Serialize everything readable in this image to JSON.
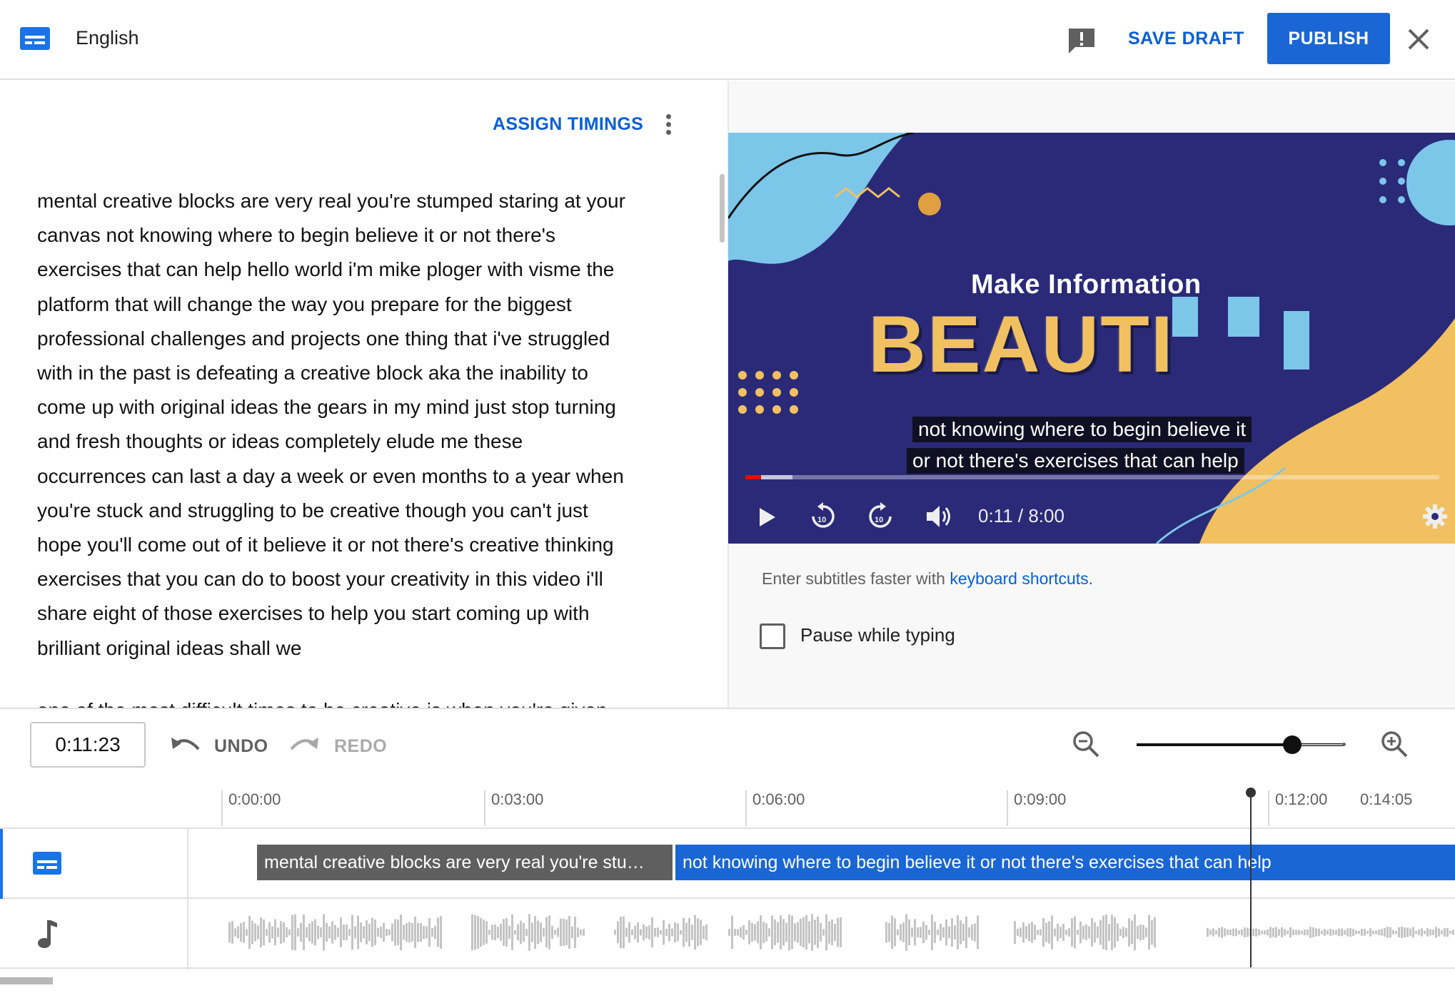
{
  "header": {
    "language": "English",
    "save_draft": "SAVE DRAFT",
    "publish": "PUBLISH"
  },
  "editor": {
    "assign_timings": "ASSIGN TIMINGS",
    "transcript": "mental creative blocks are very real you're stumped staring at your\ncanvas not knowing where to begin believe it or not there's\nexercises that can help hello world i'm mike ploger with visme the\nplatform that will change the way you prepare for the biggest\nprofessional challenges and projects one thing that i've struggled\nwith in the past is defeating a creative block aka the inability to\ncome up with original ideas the gears in my mind just stop turning\nand fresh thoughts or ideas completely elude me these\noccurrences can last a day a week or even months to a year when\nyou're stuck and struggling to be creative though you can't just\nhope you'll come out of it believe it or not there's creative thinking\nexercises that you can do to boost your creativity in this video i'll\nshare eight of those exercises to help you start coming up with\nbrilliant original ideas shall we",
    "next_paragraph_partial": "one of the most difficult times to be creative is when you're given"
  },
  "video": {
    "title_line1": "Make Information",
    "title_line2": "BEAUTI",
    "caption_line1": "not knowing where to begin believe it",
    "caption_line2": "or not there's exercises that can help",
    "time_display": "0:11 / 8:00",
    "progress_fraction": 0.023,
    "buffered_fraction": 0.068,
    "colors": {
      "background": "#2a2a78",
      "accent_blue": "#7cc6ea",
      "accent_yellow": "#f1c061"
    }
  },
  "options": {
    "hint_prefix": "Enter subtitles faster with",
    "hint_link": "keyboard shortcuts",
    "hint_suffix": ".",
    "pause_while_typing": "Pause while typing",
    "pause_while_typing_checked": false
  },
  "toolbar": {
    "current_time": "0:11:23",
    "undo": "UNDO",
    "redo": "REDO",
    "zoom_level_fraction": 0.78
  },
  "timeline": {
    "ruler": [
      "0:00:00",
      "0:03:00",
      "0:06:00",
      "0:09:00",
      "0:12:00",
      "0:14:05"
    ],
    "segments": [
      {
        "text": "mental creative blocks are very real  you're stu…",
        "state": "inactive"
      },
      {
        "text": "not knowing where to begin believe it  or not there's exercises that can help",
        "state": "active"
      }
    ]
  },
  "icons": {
    "subtitles": "subtitles-icon",
    "feedback": "feedback-icon",
    "close": "close-icon",
    "more": "more-vert-icon",
    "play": "play-icon",
    "rewind": "replay-10-icon",
    "forward": "forward-10-icon",
    "volume": "volume-icon",
    "settings": "gear-icon",
    "undo": "undo-icon",
    "redo": "redo-icon",
    "zoom_out": "zoom-out-icon",
    "zoom_in": "zoom-in-icon",
    "music": "music-note-icon"
  }
}
